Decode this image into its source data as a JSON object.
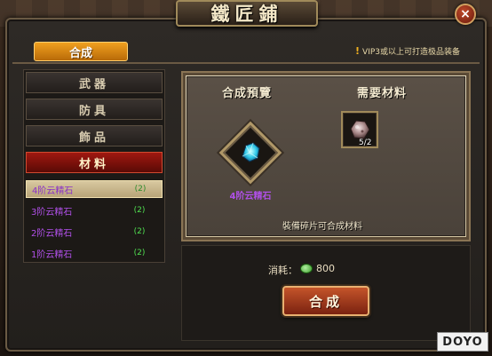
{
  "window": {
    "title": "鐵匠鋪",
    "close_glyph": "×"
  },
  "tabs": {
    "active_label": "合成"
  },
  "notice": {
    "text": "VIP3或以上可打造极品装备",
    "icon": "!"
  },
  "categories": [
    {
      "label": "武器",
      "active": false
    },
    {
      "label": "防具",
      "active": false
    },
    {
      "label": "飾品",
      "active": false
    },
    {
      "label": "材料",
      "active": true
    }
  ],
  "materials_list": [
    {
      "name": "4阶云精石",
      "count": "(2)",
      "selected": true
    },
    {
      "name": "3阶云精石",
      "count": "(2)",
      "selected": false
    },
    {
      "name": "2阶云精石",
      "count": "(2)",
      "selected": false
    },
    {
      "name": "1阶云精石",
      "count": "(2)",
      "selected": false
    }
  ],
  "preview": {
    "title": "合成預覽",
    "item_name": "4阶云精石",
    "item_icon": "cyan-gem-icon"
  },
  "required": {
    "title": "需要材料",
    "material_icon": "ore-fragment-icon",
    "count": "5/2"
  },
  "hint": "裝備碎片可合成材料",
  "cost": {
    "label": "消耗：",
    "currency_icon": "green-gem-currency-icon",
    "value": "800"
  },
  "action": {
    "compose_label": "合成"
  },
  "watermark": "DOYO",
  "colors": {
    "active_category": "#a01810",
    "tab_accent": "#f0a020",
    "item_purple": "#b050e8",
    "count_green": "#50e050"
  }
}
